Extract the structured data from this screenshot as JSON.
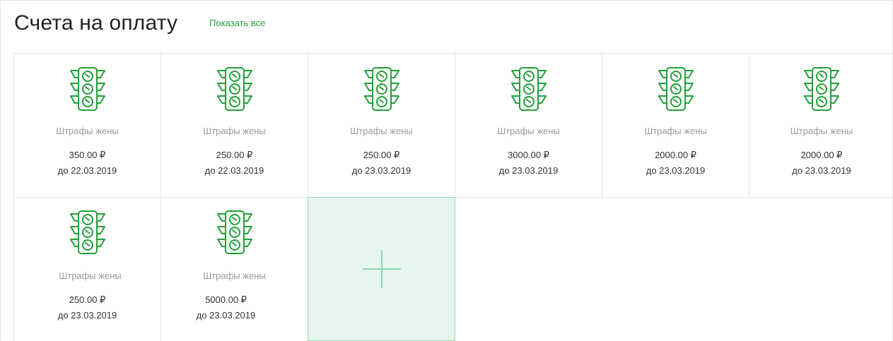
{
  "header": {
    "title": "Счета на оплату",
    "show_all": "Показать все"
  },
  "icon_color": "#21a038",
  "accent_light": "#e6f6ee",
  "invoices": [
    {
      "icon": "traffic-light-icon",
      "name": "Штрафы жены",
      "amount": "350.00 ₽",
      "due": "до 22.03.2019"
    },
    {
      "icon": "traffic-light-icon",
      "name": "Штрафы жены",
      "amount": "250.00 ₽",
      "due": "до 22.03.2019"
    },
    {
      "icon": "traffic-light-icon",
      "name": "Штрафы жены",
      "amount": "250.00 ₽",
      "due": "до 23.03.2019"
    },
    {
      "icon": "traffic-light-icon",
      "name": "Штрафы жены",
      "amount": "3000.00 ₽",
      "due": "до 23.03.2019"
    },
    {
      "icon": "traffic-light-icon",
      "name": "Штрафы жены",
      "amount": "2000.00 ₽",
      "due": "до 23.03.2019"
    },
    {
      "icon": "traffic-light-icon",
      "name": "Штрафы жены",
      "amount": "2000.00 ₽",
      "due": "до 23.03.2019"
    },
    {
      "icon": "traffic-light-icon",
      "name": "Штрафы жены",
      "amount": "250.00 ₽",
      "due": "до 23.03.2019"
    },
    {
      "icon": "traffic-light-icon",
      "name": "Штрафы жены",
      "amount": "5000.00 ₽",
      "due": "до 23.03.2019"
    }
  ],
  "add_card": {
    "icon": "plus-icon"
  }
}
